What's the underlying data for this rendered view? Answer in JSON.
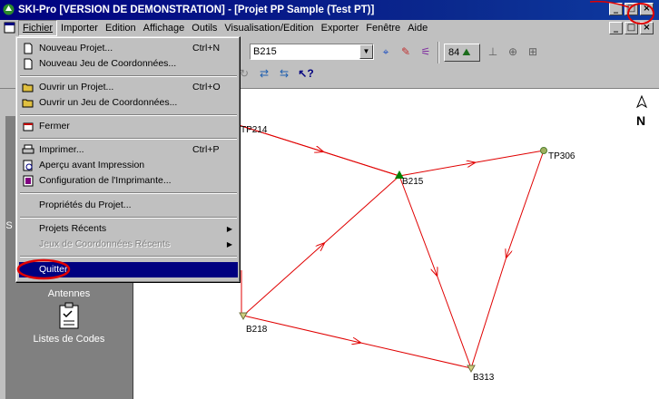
{
  "window": {
    "title": "SKI-Pro [VERSION DE DEMONSTRATION] - [Projet PP Sample (Test PT)]",
    "buttons": {
      "minimize": "_",
      "maximize": "□",
      "close": "×"
    }
  },
  "menubar": {
    "items": [
      "Fichier",
      "Importer",
      "Edition",
      "Affichage",
      "Outils",
      "Visualisation/Edition",
      "Exporter",
      "Fenêtre",
      "Aide"
    ]
  },
  "toolbar": {
    "point_select": "B215",
    "count": "84"
  },
  "fichier_menu": {
    "nouveau_projet": {
      "label": "Nouveau Projet...",
      "shortcut": "Ctrl+N"
    },
    "nouveau_jeu": {
      "label": "Nouveau Jeu de Coordonnées..."
    },
    "ouvrir_projet": {
      "label": "Ouvrir un Projet...",
      "shortcut": "Ctrl+O"
    },
    "ouvrir_jeu": {
      "label": "Ouvrir un Jeu de Coordonnées..."
    },
    "fermer": {
      "label": "Fermer"
    },
    "imprimer": {
      "label": "Imprimer...",
      "shortcut": "Ctrl+P"
    },
    "apercu": {
      "label": "Aperçu avant Impression"
    },
    "config_imprimante": {
      "label": "Configuration de l'Imprimante..."
    },
    "proprietes": {
      "label": "Propriétés du Projet..."
    },
    "projets_recents": {
      "label": "Projets Récents"
    },
    "jeux_recents": {
      "label": "Jeux de Coordonnées Récents"
    },
    "quitter": {
      "label": "Quitter"
    }
  },
  "left_panel": {
    "antennes": "Antennes",
    "listes_codes": "Listes de Codes",
    "partial_letter": "S"
  },
  "map": {
    "north_label": "N",
    "points": {
      "tp214": "TP214",
      "b215": "B215",
      "tp306": "TP306",
      "b218": "B218",
      "b313": "B313"
    },
    "colors": {
      "line": "#e00000",
      "triangle": "#008000",
      "station": "#a0b060"
    }
  },
  "annotations": {
    "color": "#e00000"
  }
}
